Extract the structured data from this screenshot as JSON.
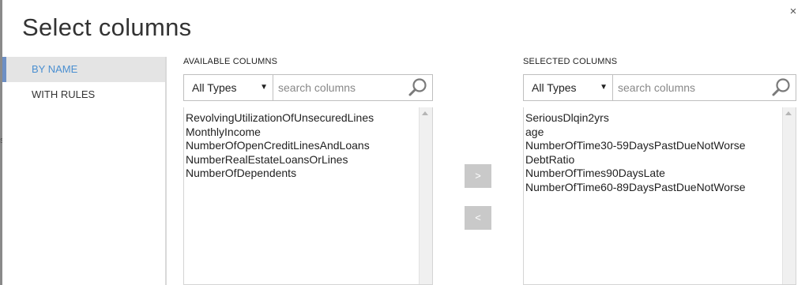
{
  "dialog": {
    "title": "Select columns",
    "close_label": "×",
    "edge_mark": "s"
  },
  "sidebar": {
    "items": [
      {
        "label": "BY NAME",
        "active": true
      },
      {
        "label": "WITH RULES",
        "active": false
      }
    ]
  },
  "available": {
    "title": "AVAILABLE COLUMNS",
    "type_filter": "All Types",
    "search_placeholder": "search columns",
    "columns": [
      "RevolvingUtilizationOfUnsecuredLines",
      "MonthlyIncome",
      "NumberOfOpenCreditLinesAndLoans",
      "NumberRealEstateLoansOrLines",
      "NumberOfDependents"
    ]
  },
  "transfer": {
    "add_label": ">",
    "remove_label": "<"
  },
  "selected": {
    "title": "SELECTED COLUMNS",
    "type_filter": "All Types",
    "search_placeholder": "search columns",
    "columns": [
      "SeriousDlqin2yrs",
      "age",
      "NumberOfTime30-59DaysPastDueNotWorse",
      "DebtRatio",
      "NumberOfTimes90DaysLate",
      "NumberOfTime60-89DaysPastDueNotWorse"
    ]
  },
  "colors": {
    "accent": "#4a8fd1",
    "active_bar": "#6d8fc4",
    "active_bg": "#e4e4e4",
    "button_bg": "#c9c9c9"
  }
}
